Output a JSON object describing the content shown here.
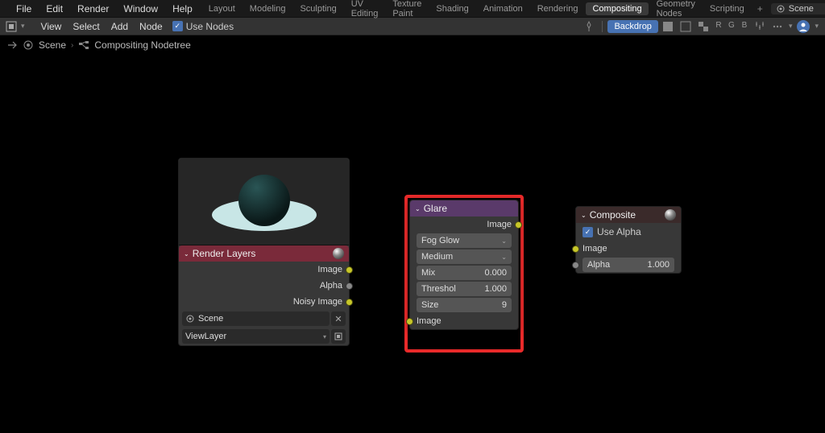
{
  "menubar": {
    "main": [
      "File",
      "Edit",
      "Render",
      "Window",
      "Help"
    ],
    "tabs": [
      "Layout",
      "Modeling",
      "Sculpting",
      "UV Editing",
      "Texture Paint",
      "Shading",
      "Animation",
      "Rendering",
      "Compositing",
      "Geometry Nodes",
      "Scripting"
    ],
    "active_tab": "Compositing",
    "scene_label": "Scene"
  },
  "toolbar2": {
    "items": [
      "View",
      "Select",
      "Add",
      "Node"
    ],
    "use_nodes_label": "Use Nodes",
    "use_nodes_checked": true,
    "backdrop_label": "Backdrop",
    "channels": [
      "R",
      "G",
      "B"
    ]
  },
  "breadcrumb": {
    "scene": "Scene",
    "nodetree": "Compositing Nodetree"
  },
  "nodes": {
    "render_layers": {
      "title": "Render Layers",
      "outputs": [
        "Image",
        "Alpha",
        "Noisy Image"
      ],
      "scene_value": "Scene",
      "viewlayer_value": "ViewLayer"
    },
    "glare": {
      "title": "Glare",
      "output": "Image",
      "type_value": "Fog Glow",
      "quality_value": "Medium",
      "mix_label": "Mix",
      "mix_value": "0.000",
      "threshold_label": "Threshol",
      "threshold_value": "1.000",
      "size_label": "Size",
      "size_value": "9",
      "input": "Image"
    },
    "composite": {
      "title": "Composite",
      "use_alpha_label": "Use Alpha",
      "use_alpha_checked": true,
      "image_input": "Image",
      "alpha_label": "Alpha",
      "alpha_value": "1.000"
    }
  }
}
